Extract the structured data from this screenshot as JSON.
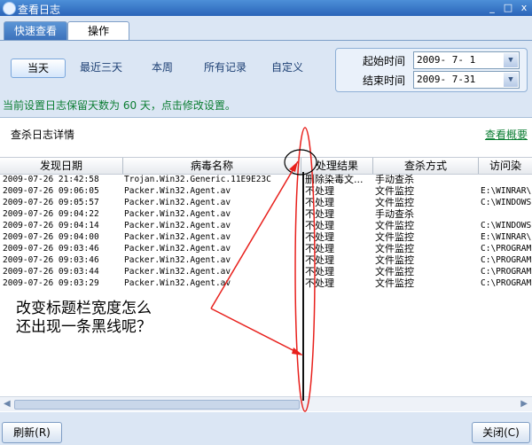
{
  "window": {
    "title": "查看日志",
    "min": "_",
    "max": "□",
    "close": "x"
  },
  "tabs": [
    {
      "label": "快速查看"
    },
    {
      "label": "操作"
    }
  ],
  "quick": [
    {
      "label": "当天"
    },
    {
      "label": "最近三天"
    },
    {
      "label": "本周"
    },
    {
      "label": "所有记录"
    },
    {
      "label": "自定义"
    }
  ],
  "dates": {
    "start_label": "起始时间",
    "start_value": "2009- 7- 1",
    "end_label": "结束时间",
    "end_value": "2009- 7-31"
  },
  "notice": "当前设置日志保留天数为 60 天，点击修改设置。",
  "content": {
    "title": "查杀日志详情",
    "summary_link": "查看概要"
  },
  "table": {
    "columns": [
      "发现日期",
      "病毒名称",
      "处理结果",
      "查杀方式",
      "访问染"
    ],
    "rows": [
      [
        "2009-07-26 21:42:58",
        "Trojan.Win32.Generic.11E9E23C",
        "删除染毒文...",
        "手动查杀",
        ""
      ],
      [
        "2009-07-26 09:06:05",
        "Packer.Win32.Agent.av",
        "不处理",
        "文件监控",
        "E:\\WINRAR\\"
      ],
      [
        "2009-07-26 09:05:57",
        "Packer.Win32.Agent.av",
        "不处理",
        "文件监控",
        "C:\\WINDOWS"
      ],
      [
        "2009-07-26 09:04:22",
        "Packer.Win32.Agent.av",
        "不处理",
        "手动查杀",
        ""
      ],
      [
        "2009-07-26 09:04:14",
        "Packer.Win32.Agent.av",
        "不处理",
        "文件监控",
        "C:\\WINDOWS"
      ],
      [
        "2009-07-26 09:04:00",
        "Packer.Win32.Agent.av",
        "不处理",
        "文件监控",
        "E:\\WINRAR\\"
      ],
      [
        "2009-07-26 09:03:46",
        "Packer.Win32.Agent.av",
        "不处理",
        "文件监控",
        "C:\\PROGRAM"
      ],
      [
        "2009-07-26 09:03:46",
        "Packer.Win32.Agent.av",
        "不处理",
        "文件监控",
        "C:\\PROGRAM"
      ],
      [
        "2009-07-26 09:03:44",
        "Packer.Win32.Agent.av",
        "不处理",
        "文件监控",
        "C:\\PROGRAM"
      ],
      [
        "2009-07-26 09:03:29",
        "Packer.Win32.Agent.av",
        "不处理",
        "文件监控",
        "C:\\PROGRAM"
      ]
    ]
  },
  "annotation": {
    "line1": "改变标题栏宽度怎么",
    "line2": "还出现一条黑线呢？"
  },
  "buttons": {
    "refresh": "刷新(R)",
    "close": "关闭(C)"
  },
  "colors": {
    "annotation_red": "#e8201c",
    "notice_green": "#0b7d32"
  }
}
